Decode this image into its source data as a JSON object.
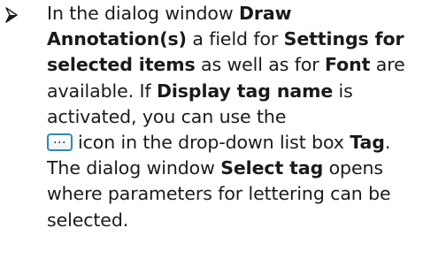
{
  "bullet": {
    "icon": "arrowhead-bullet-icon"
  },
  "paragraph": {
    "t1": "In the dialog window ",
    "b1": "Draw Annotation(s)",
    "t2": " a field for ",
    "b2": "Settings for selected items",
    "t3": " as well as for ",
    "b3": "Font",
    "t4": " are available. If ",
    "b4": "Display tag name",
    "t5": " is activated, you can use the ",
    "icon_text": "...",
    "t6": "icon in the drop-down list box ",
    "b5": "Tag",
    "t7": ". The dialog window ",
    "b6": "Select tag",
    "t8": " opens where parameters for lettering can be selected."
  }
}
